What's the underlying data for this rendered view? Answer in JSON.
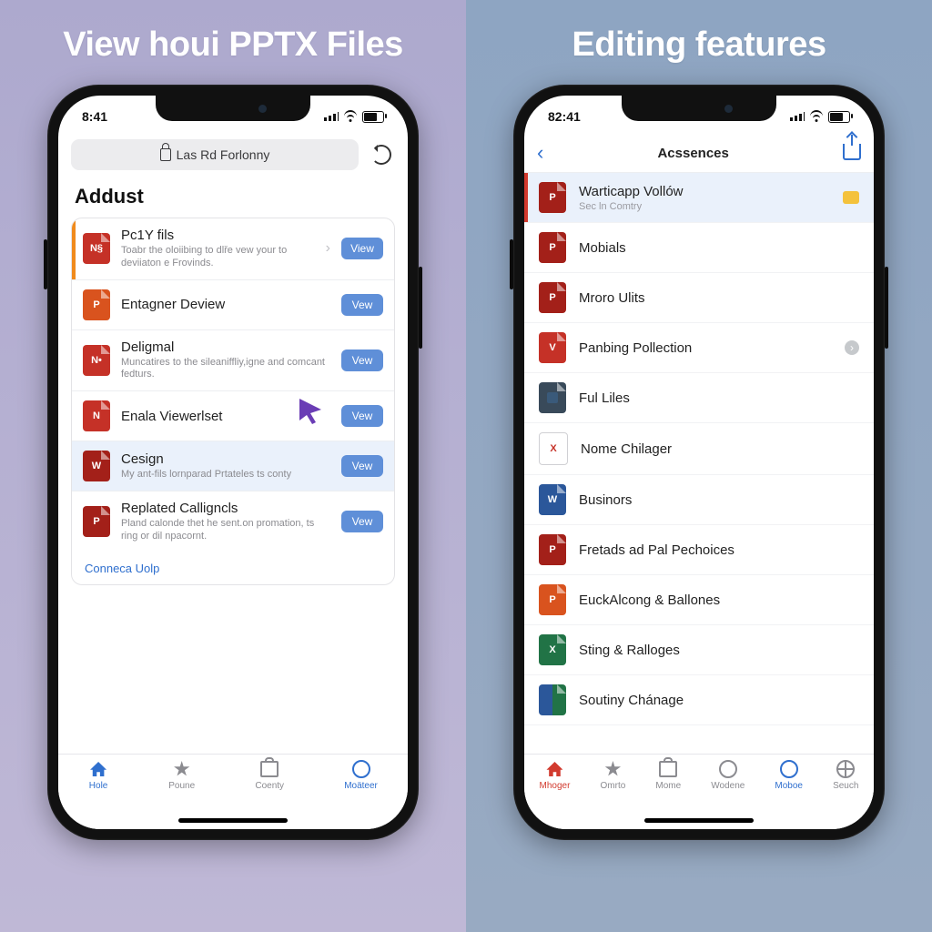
{
  "panels": {
    "left_title": "View houi PPTX Files",
    "right_title": "Editing features"
  },
  "status": {
    "time": "8:41",
    "time_r": "82:41"
  },
  "left": {
    "url_label": "Las Rd Forlonny",
    "section": "Addust",
    "items": [
      {
        "title": "Pc1Y fils",
        "sub": "Toabr the oloiibing to dlře vew your to deviiaton e Frovinds.",
        "btn": "View",
        "accent": true,
        "chev": true
      },
      {
        "title": "Entagner Deview",
        "sub": "",
        "btn": "Vew"
      },
      {
        "title": "Deligmal",
        "sub": "Muncatires to the sileaniffliy,igne and comcant fedturs.",
        "btn": "Vew"
      },
      {
        "title": "Enala Viewerlset",
        "sub": "",
        "btn": "Vew"
      },
      {
        "title": "Cesign",
        "sub": "My ant-fils lornparad Prtateles ts conty",
        "btn": "Vew",
        "sel": true
      },
      {
        "title": "Replated Calligncls",
        "sub": "Pland calonde thet he sent.on promation, ts ring or dil npacornt.",
        "btn": "Vew"
      }
    ],
    "link": "Conneca Uolp",
    "tabs": [
      {
        "label": "Hole"
      },
      {
        "label": "Poune"
      },
      {
        "label": "Coenty"
      },
      {
        "label": "Moäteer"
      }
    ]
  },
  "right": {
    "nav_title": "Acssences",
    "items": [
      {
        "title": "Warticapp Vollów",
        "sub": "Sec ln Comtry",
        "hl": true,
        "badge": "yellow"
      },
      {
        "title": "Mobials"
      },
      {
        "title": "Mroro Ulits"
      },
      {
        "title": "Panbing Pollection",
        "badge": "grey"
      },
      {
        "title": "Ful Liles"
      },
      {
        "title": "Nome Chilager"
      },
      {
        "title": "Businors"
      },
      {
        "title": "Fretads ad Pal Pechoices"
      },
      {
        "title": "EuckAlcong & Ballones"
      },
      {
        "title": "Sting & Ralloges"
      },
      {
        "title": "Soutiny Chánage"
      }
    ],
    "tabs": [
      {
        "label": "Mhoger"
      },
      {
        "label": "Omrto"
      },
      {
        "label": "Mome"
      },
      {
        "label": "Wodene"
      },
      {
        "label": "Moboe"
      },
      {
        "label": "Seuch"
      }
    ]
  }
}
